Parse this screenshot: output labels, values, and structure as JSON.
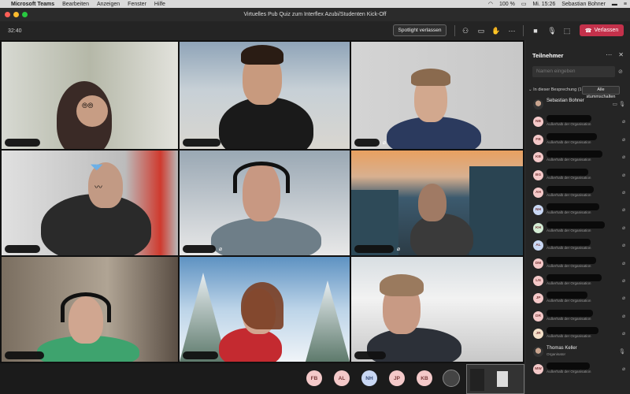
{
  "menubar": {
    "app_name": "Microsoft Teams",
    "items": [
      "Bearbeiten",
      "Anzeigen",
      "Fenster",
      "Hilfe"
    ],
    "battery": "100 %",
    "clock": "Mi. 15:26",
    "user": "Sebastian Bohner"
  },
  "window": {
    "title": "Virtuelles Pub Quiz zum Interflex Azubi/Studenten Kick-Off"
  },
  "toolbar": {
    "timer": "32:40",
    "spotlight_label": "Spotlight verlassen",
    "leave_label": "Verlassen",
    "icons": [
      "participants-icon",
      "chat-icon",
      "raise-hand-icon",
      "more-icon",
      "camera-icon",
      "mic-icon",
      "share-icon"
    ]
  },
  "bottom_bar": {
    "avatars": [
      {
        "initials": "FB",
        "color": "#f4c9c9"
      },
      {
        "initials": "AL",
        "color": "#f4c9c9"
      },
      {
        "initials": "NH",
        "color": "#c9d8f4"
      },
      {
        "initials": "JP",
        "color": "#f4c9c9"
      },
      {
        "initials": "KB",
        "color": "#f4c9c9"
      }
    ]
  },
  "panel": {
    "title": "Teilnehmer",
    "search_placeholder": "Namen eingeben",
    "section_label": "In dieser Besprechung (16)",
    "mute_all_label": "Alle stummschalten",
    "participants": [
      {
        "initials": "",
        "name": "Sebastian Bohner",
        "org": "",
        "is_photo": true
      },
      {
        "initials": "NB",
        "name": "",
        "org": "Außerhalb der Organisation",
        "color": "#f4c9c9"
      },
      {
        "initials": "FB",
        "name": "",
        "org": "Außerhalb der Organisation",
        "color": "#f4c9c9"
      },
      {
        "initials": "KB",
        "name": "",
        "org": "Außerhalb der Organisation",
        "color": "#f4c9c9"
      },
      {
        "initials": "BG",
        "name": "",
        "org": "Außerhalb der Organisation",
        "color": "#f4c9c9"
      },
      {
        "initials": "AH",
        "name": "",
        "org": "Außerhalb der Organisation",
        "color": "#f4c9c9"
      },
      {
        "initials": "NH",
        "name": "",
        "org": "Außerhalb der Organisation",
        "color": "#c9d8f4"
      },
      {
        "initials": "KH",
        "name": "",
        "org": "Außerhalb der Organisation",
        "color": "#d4ecd4"
      },
      {
        "initials": "AL",
        "name": "",
        "org": "Außerhalb der Organisation",
        "color": "#c9d8f4"
      },
      {
        "initials": "DM",
        "name": "",
        "org": "Außerhalb der Organisation",
        "color": "#f4c9c9"
      },
      {
        "initials": "LN",
        "name": "",
        "org": "Außerhalb der Organisation",
        "color": "#f4c9c9"
      },
      {
        "initials": "JP",
        "name": "",
        "org": "Außerhalb der Organisation",
        "color": "#f4c9c9"
      },
      {
        "initials": "DR",
        "name": "",
        "org": "Außerhalb der Organisation",
        "color": "#f4c9c9"
      },
      {
        "initials": "JR",
        "name": "",
        "org": "Außerhalb der Organisation",
        "color": "#f4e0c9"
      },
      {
        "initials": "",
        "name": "Thomas Keller",
        "org": "Organisator",
        "is_photo": true
      },
      {
        "initials": "MW",
        "name": "",
        "org": "Außerhalb der Organisation",
        "color": "#f4c9c9"
      }
    ]
  },
  "colors": {
    "leave": "#c4314b",
    "background": "#1b1b1b",
    "panel": "#252525"
  }
}
